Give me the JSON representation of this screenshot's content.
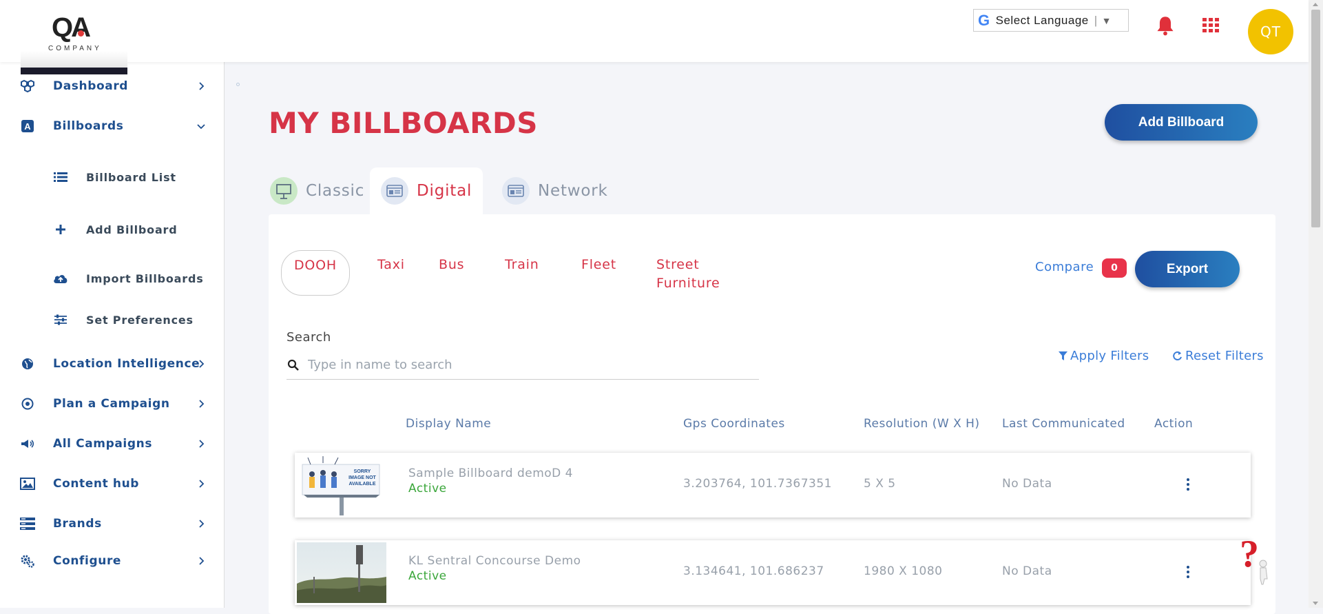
{
  "header": {
    "logo_text": "QA",
    "logo_sub": "COMPANY",
    "language_label": "Select Language",
    "language_g": "G",
    "language_sep": "|",
    "language_arrow": "▼",
    "avatar_initials": "QT",
    "accent_color": "#d63447"
  },
  "sidebar": {
    "items": [
      {
        "label": "Dashboard",
        "icon": "dashboard-icon"
      },
      {
        "label": "Billboards",
        "icon": "billboard-icon"
      },
      {
        "label": "Location Intelligence",
        "icon": "globe-icon"
      },
      {
        "label": "Plan a Campaign",
        "icon": "target-icon"
      },
      {
        "label": "All Campaigns",
        "icon": "megaphone-icon"
      },
      {
        "label": "Content hub",
        "icon": "image-icon"
      },
      {
        "label": "Brands",
        "icon": "brands-icon"
      },
      {
        "label": "Configure",
        "icon": "gears-icon"
      }
    ],
    "subitems": [
      {
        "label": "Billboard List",
        "icon": "list-icon"
      },
      {
        "label": "Add Billboard",
        "icon": "plus-icon"
      },
      {
        "label": "Import Billboards",
        "icon": "cloud-upload-icon"
      },
      {
        "label": "Set Preferences",
        "icon": "sliders-icon"
      }
    ]
  },
  "main": {
    "title": "MY BILLBOARDS",
    "add_button": "Add Billboard",
    "tabs": [
      {
        "label": "Classic",
        "active": false
      },
      {
        "label": "Digital",
        "active": true
      },
      {
        "label": "Network",
        "active": false
      }
    ],
    "subtabs": [
      {
        "label": "DOOH",
        "active": true
      },
      {
        "label": "Taxi"
      },
      {
        "label": "Bus"
      },
      {
        "label": "Train"
      },
      {
        "label": "Fleet"
      },
      {
        "label": "Street",
        "label2": "Furniture"
      }
    ],
    "compare_label": "Compare",
    "compare_count": "0",
    "export_button": "Export",
    "search_label": "Search",
    "search_placeholder": "Type in name to search",
    "apply_filters": "Apply Filters",
    "reset_filters": "Reset Filters",
    "columns": [
      "Display Name",
      "Gps Coordinates",
      "Resolution (W X H)",
      "Last Communicated",
      "Action"
    ],
    "rows": [
      {
        "name": "Sample Billboard demoD 4",
        "status": "Active",
        "gps": "3.203764, 101.7367351",
        "resolution": "5 X 5",
        "last": "No Data",
        "thumb_text1": "SORRY",
        "thumb_text2": "IMAGE NOT",
        "thumb_text3": "AVAILABLE"
      },
      {
        "name": "KL Sentral Concourse Demo",
        "status": "Active",
        "gps": "3.134641, 101.686237",
        "resolution": "1980 X 1080",
        "last": "No Data"
      }
    ]
  }
}
